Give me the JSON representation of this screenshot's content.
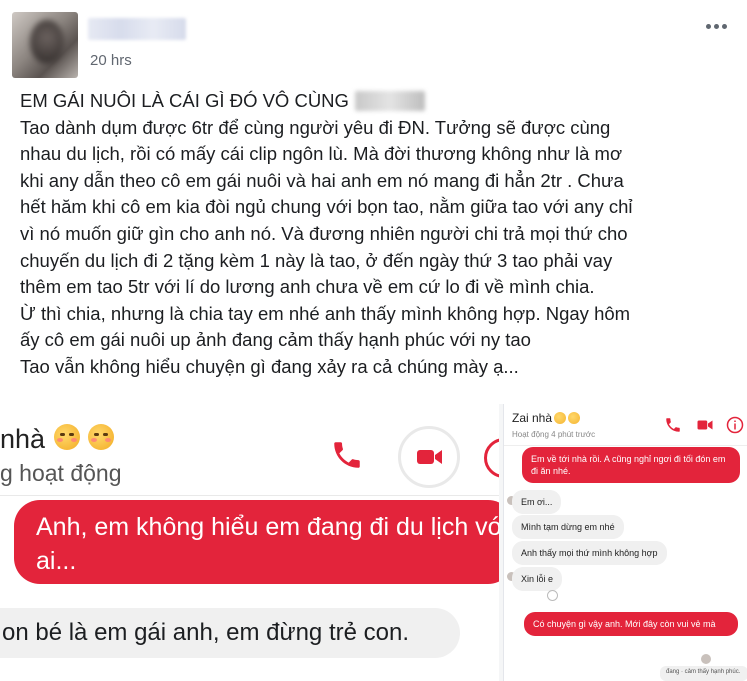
{
  "post": {
    "timestamp": "20 hrs",
    "lines": [
      "EM GÁI NUÔI LÀ CÁI GÌ ĐÓ VÔ CÙNG",
      "Tao dành dụm được 6tr để cùng người yêu đi ĐN. Tưởng sẽ được cùng",
      "nhau du lịch, rồi có mấy cái clip ngôn lù. Mà đời thương không như là mơ",
      "khi any dẫn theo cô em gái nuôi và hai anh em nó mang đi hẳn 2tr . Chưa",
      "hết hăm khi cô em kia đòi ngủ chung với bọn tao, nằm giữa tao với any chỉ",
      "vì nó muốn giữ gìn cho anh nó. Và đương nhiên người chi trả mọi thứ cho",
      "chuyến du lịch đi 2 tặng kèm 1 này là tao, ở đến ngày thứ 3 tao phải vay",
      "thêm em tao 5tr với lí do lương anh chưa về em cứ lo đi về mình chia.",
      "Ừ thì chia, nhưng là chia tay em nhé anh thấy mình không hợp. Ngay hôm",
      "ấy cô em gái nuôi up ảnh đang cảm thấy hạnh phúc với ny tao",
      "Tao vẫn không hiểu chuyện gì đang xảy ra cả chúng mày ạ..."
    ]
  },
  "left_screenshot": {
    "contact_name": "nhà",
    "status": "g hoạt động",
    "message_sent": "Anh, em không hiểu em đang đi du lịch với ai...",
    "message_received": "on bé là em gái anh, em đừng trẻ con."
  },
  "right_screenshot": {
    "contact_name": "Zai nhà",
    "status": "Hoạt động 4 phút trước",
    "messages": [
      "Em về tới nhà rồi. A cũng nghỉ ngơi đi tối đón em đi ăn nhé.",
      "Em ơi...",
      "Mình tạm dừng em nhé",
      "Anh thấy mọi thứ mình không hợp",
      "Xin lỗi e",
      "Có chuyện gì vậy anh. Mới đây còn vui vẻ mà",
      "đang · cảm thấy hạnh phúc."
    ]
  },
  "colors": {
    "messenger_red": "#e3243b",
    "bubble_gray": "#f0f0f0",
    "timestamp_gray": "#616770"
  },
  "icons": [
    "more-options-icon",
    "phone-icon",
    "video-call-icon",
    "info-icon",
    "smiley-icon"
  ]
}
